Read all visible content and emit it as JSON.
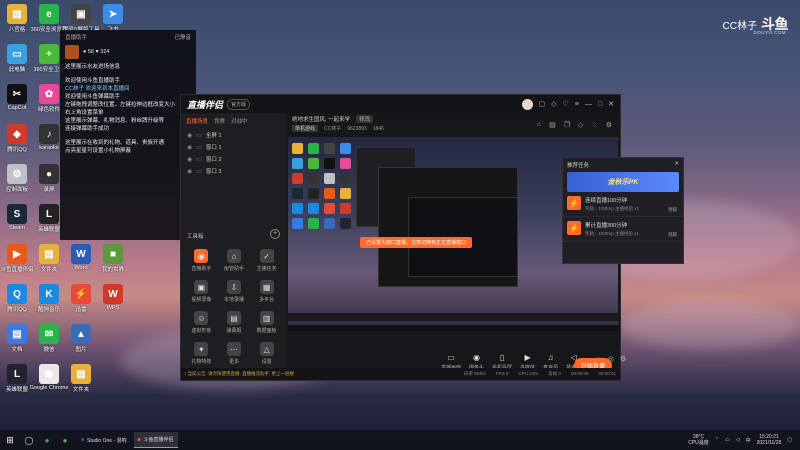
{
  "brand": {
    "text": "CC林子",
    "logo": "斗鱼",
    "sub": "DOUYU.COM"
  },
  "desktop_icons": [
    {
      "label": "八宫格",
      "col": 0,
      "row": 0,
      "color": "#e8b23a",
      "glyph": "▤"
    },
    {
      "label": "360安全浏览器",
      "col": 1,
      "row": 0,
      "color": "#2ab34a",
      "glyph": "e"
    },
    {
      "label": "国风D屏版工具",
      "col": 2,
      "row": 0,
      "color": "#444",
      "glyph": "▣"
    },
    {
      "label": "飞书",
      "col": 3,
      "row": 0,
      "color": "#3a8ee8",
      "glyph": "➤"
    },
    {
      "label": "此电脑",
      "col": 0,
      "row": 1,
      "color": "#3aa0e0",
      "glyph": "▭"
    },
    {
      "label": "360安全卫士",
      "col": 1,
      "row": 1,
      "color": "#4ab83a",
      "glyph": "+"
    },
    {
      "label": "CapCut",
      "col": 0,
      "row": 2,
      "color": "#111",
      "glyph": "✂"
    },
    {
      "label": "绿色软件",
      "col": 1,
      "row": 2,
      "color": "#e84a9a",
      "glyph": "✿"
    },
    {
      "label": "腾讯QQ",
      "col": 0,
      "row": 3,
      "color": "#d03a2a",
      "glyph": "◆"
    },
    {
      "label": "karaoke",
      "col": 1,
      "row": 3,
      "color": "#333",
      "glyph": "♪"
    },
    {
      "label": "控制面板",
      "col": 0,
      "row": 4,
      "color": "#c0c0c8",
      "glyph": "⚙"
    },
    {
      "label": "录屏",
      "col": 1,
      "row": 4,
      "color": "#333",
      "glyph": "●"
    },
    {
      "label": "Steam",
      "col": 0,
      "row": 5,
      "color": "#1b2838",
      "glyph": "S"
    },
    {
      "label": "英雄联盟",
      "col": 1,
      "row": 5,
      "color": "#222",
      "glyph": "L"
    },
    {
      "label": "斗鱼直播伴侣",
      "col": 0,
      "row": 6,
      "color": "#e85a1a",
      "glyph": "▶"
    },
    {
      "label": "文件夹",
      "col": 1,
      "row": 6,
      "color": "#e8b23a",
      "glyph": "▤"
    },
    {
      "label": "Word",
      "col": 2,
      "row": 6,
      "color": "#2b5cb8",
      "glyph": "W"
    },
    {
      "label": "我的世界",
      "col": 3,
      "row": 6,
      "color": "#5a9a3a",
      "glyph": "■"
    },
    {
      "label": "腾讯QQ",
      "col": 0,
      "row": 7,
      "color": "#1a8ae0",
      "glyph": "Q"
    },
    {
      "label": "酷狗音乐",
      "col": 1,
      "row": 7,
      "color": "#1a8ae0",
      "glyph": "K"
    },
    {
      "label": "迅雷",
      "col": 2,
      "row": 7,
      "color": "#e84a3a",
      "glyph": "⚡"
    },
    {
      "label": "WPS",
      "col": 3,
      "row": 7,
      "color": "#d03a2a",
      "glyph": "W"
    },
    {
      "label": "文档",
      "col": 0,
      "row": 8,
      "color": "#3a7ae0",
      "glyph": "▤"
    },
    {
      "label": "微信",
      "col": 1,
      "row": 8,
      "color": "#2ab34a",
      "glyph": "✉"
    },
    {
      "label": "图片",
      "col": 2,
      "row": 8,
      "color": "#3a6ab8",
      "glyph": "▲"
    },
    {
      "label": "英雄联盟",
      "col": 0,
      "row": 9,
      "color": "#223",
      "glyph": "L"
    },
    {
      "label": "Google Chrome",
      "col": 1,
      "row": 9,
      "color": "#e8e8e8",
      "glyph": "◉"
    },
    {
      "label": "文件夹",
      "col": 2,
      "row": 9,
      "color": "#e8b23a",
      "glyph": "▤"
    }
  ],
  "overlay": {
    "head_left": "直播助手",
    "head_right": "已静音",
    "stream_stats": "● 56   ♥ 324",
    "lines": [
      {
        "text": "这里展示水友进场信息",
        "hl": false
      },
      {
        "text": "",
        "hl": false
      },
      {
        "text": "欢迎使用斗鱼直播助手",
        "hl": false
      },
      {
        "text": "CC林子 欢迎来到本直播间",
        "hl": true
      },
      {
        "text": "欢迎使用斗鱼弹幕助手",
        "hl": false
      },
      {
        "text": "左键拖拽调整改位置，左键拉伸边框改变大小",
        "hl": false
      },
      {
        "text": "右上角设置菜单",
        "hl": false
      },
      {
        "text": "这里展示弹幕、礼物消息、粉丝牌升级等",
        "hl": false
      },
      {
        "text": "连接弹幕助手成功",
        "hl": false
      },
      {
        "text": "",
        "hl": false
      },
      {
        "text": "这里展示在收到的礼物、道具、贵族开通",
        "hl": false
      },
      {
        "text": "点亮星星可设置小礼物屏蔽",
        "hl": false
      }
    ]
  },
  "app": {
    "title": "直播伴侣",
    "version": "官方版",
    "tabs": [
      "直播场景",
      "竞赛",
      "对战中"
    ],
    "active_tab": "直播场景",
    "scenes": [
      "全屏 1",
      "窗口 1",
      "窗口 2",
      "窗口 3"
    ],
    "section_label": "工具箱",
    "tools": [
      {
        "label": "直播助手",
        "glyph": "◉",
        "color": "#ff6a2a"
      },
      {
        "label": "房管助手",
        "glyph": "⌂",
        "color": "#444"
      },
      {
        "label": "主播任务",
        "glyph": "✓",
        "color": "#444"
      },
      {
        "label": "视频录像",
        "glyph": "▣",
        "color": "#444"
      },
      {
        "label": "本地录播",
        "glyph": "⇩",
        "color": "#444"
      },
      {
        "label": "多平台",
        "glyph": "▦",
        "color": "#444"
      },
      {
        "label": "虚拟形象",
        "glyph": "☺",
        "color": "#444"
      },
      {
        "label": "弹幕姬",
        "glyph": "▤",
        "color": "#444"
      },
      {
        "label": "数据面板",
        "glyph": "▥",
        "color": "#444"
      },
      {
        "label": "礼物特效",
        "glyph": "✦",
        "color": "#444"
      },
      {
        "label": "更多",
        "glyph": "⋯",
        "color": "#444"
      },
      {
        "label": "设置",
        "glyph": "△",
        "color": "#444"
      }
    ],
    "room_title": "绝地求生国风, 一起来学",
    "room_tag": "修改",
    "room_category": "单机游戏",
    "room_host": "CC林子",
    "room_id": "9623893",
    "room_fans": "1846",
    "preview_banner": "已设置为窗口直播，注意切换到正在直播窗口",
    "popup": {
      "title": "推荐任务",
      "banner": "金秋乐PK",
      "tasks": [
        {
          "title": "连续直播100分钟",
          "sub": "奖励：100Exp  主播经验 x1",
          "btn": "领取"
        },
        {
          "title": "累计直播300分钟",
          "sub": "奖励：100Exp  主播经验 x1",
          "btn": "领取"
        }
      ]
    },
    "controls": [
      {
        "label": "直播画面",
        "glyph": "▭"
      },
      {
        "label": "摄像头",
        "glyph": "◉"
      },
      {
        "label": "手机投屏",
        "glyph": "▯"
      },
      {
        "label": "多媒体",
        "glyph": "▶"
      },
      {
        "label": "麦克风",
        "glyph": "♫"
      },
      {
        "label": "扬声器",
        "glyph": "◁"
      }
    ],
    "go_live": "开始直播",
    "status": {
      "warn": "! 当前公告: 请尽快使用直播, 直播推流助手, 更上一层楼",
      "bitrate": "码率 0Kb/s",
      "fps": "FPS 0",
      "cpu": "CPU 24%",
      "dropped": "丢帧 0",
      "time1": "00:00:00",
      "time2": "00:00:01"
    }
  },
  "taskbar": {
    "apps": [
      {
        "label": "Studio One - 混响",
        "active": false
      },
      {
        "label": "斗鱼直播伴侣",
        "active": true
      }
    ],
    "weather_temp": "38°C",
    "weather_label": "CPU温度",
    "lang": "中",
    "time": "15:20:21",
    "date": "2021/11/28"
  }
}
